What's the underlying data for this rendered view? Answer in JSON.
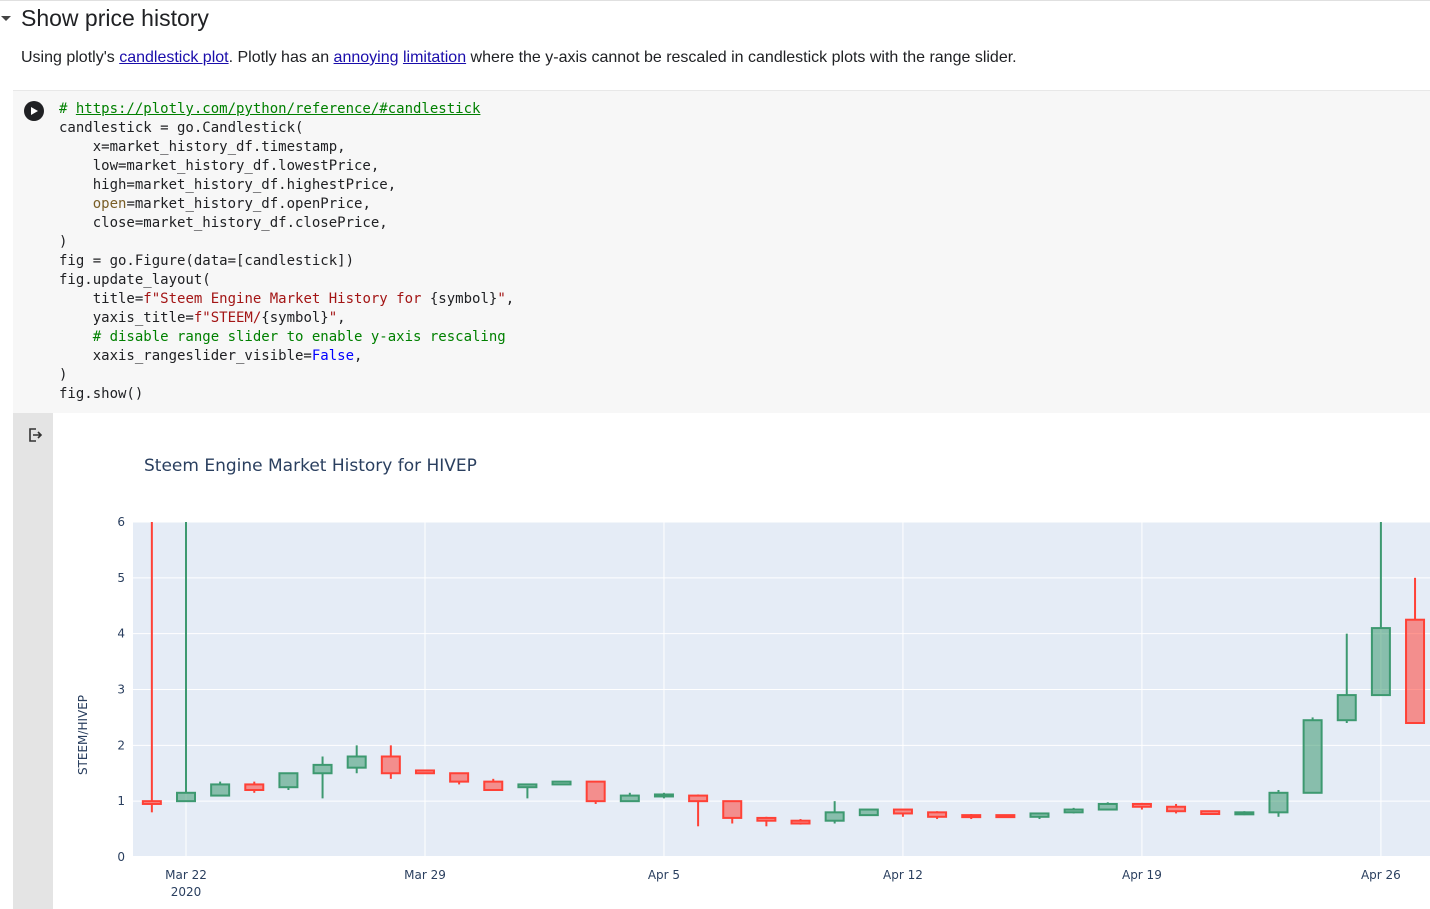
{
  "section": {
    "title": "Show price history",
    "caret_icon": "caret-down-icon"
  },
  "description": {
    "prefix": "Using plotly's ",
    "link1": "candlestick plot",
    "mid": ". Plotly has an ",
    "link2": "annoying",
    "space": " ",
    "link3": "limitation",
    "suffix": " where the y-axis cannot be rescaled in candlestick plots with the range slider."
  },
  "cell": {
    "run_icon": "play-icon",
    "output_icon": "output-redirect-icon",
    "code": {
      "l1_hash": "# ",
      "l1_url": "https://plotly.com/python/reference/#candlestick",
      "l2": "candlestick = go.Candlestick(",
      "l3": "    x=market_history_df.timestamp,",
      "l4": "    low=market_history_df.lowestPrice,",
      "l5": "    high=market_history_df.highestPrice,",
      "l6_indent": "    ",
      "l6_kw": "open",
      "l6_rest": "=market_history_df.openPrice,",
      "l7": "    close=market_history_df.closePrice,",
      "l8": ")",
      "l9": "fig = go.Figure(data=[candlestick])",
      "l10": "fig.update_layout(",
      "l11_a": "    title=",
      "l11_str1": "f\"Steem Engine Market History for ",
      "l11_var": "{symbol}",
      "l11_str2": "\"",
      "l11_end": ",",
      "l12_a": "    yaxis_title=",
      "l12_str1": "f\"STEEM/",
      "l12_var": "{symbol}",
      "l12_str2": "\"",
      "l12_end": ",",
      "l13": "    # disable range slider to enable y-axis rescaling",
      "l14_a": "    xaxis_rangeslider_visible=",
      "l14_kw": "False",
      "l14_end": ",",
      "l15": ")",
      "l16": "fig.show()"
    }
  },
  "chart_data": {
    "type": "candlestick",
    "title": "Steem Engine Market History for HIVEP",
    "ylabel": "STEEM/HIVEP",
    "xlabel": "",
    "ylim": [
      0,
      6
    ],
    "yticks": [
      0,
      1,
      2,
      3,
      4,
      5,
      6
    ],
    "xticks": [
      {
        "label": "Mar 22",
        "sub": "2020",
        "day": 0
      },
      {
        "label": "Mar 29",
        "sub": "",
        "day": 7
      },
      {
        "label": "Apr 5",
        "sub": "",
        "day": 14
      },
      {
        "label": "Apr 12",
        "sub": "",
        "day": 21
      },
      {
        "label": "Apr 19",
        "sub": "",
        "day": 28
      },
      {
        "label": "Apr 26",
        "sub": "",
        "day": 35
      }
    ],
    "grid": true,
    "legend": "none",
    "colors": {
      "increasing": "#3d9970",
      "decreasing": "#ff4136",
      "plot_bg": "#e5ecf6",
      "text": "#2a3f5f"
    },
    "candles": [
      {
        "day": -1,
        "open": 1.0,
        "high": 6.0,
        "low": 0.8,
        "close": 0.95
      },
      {
        "day": 0,
        "open": 1.0,
        "high": 6.0,
        "low": 1.0,
        "close": 1.15
      },
      {
        "day": 1,
        "open": 1.1,
        "high": 1.35,
        "low": 1.1,
        "close": 1.3
      },
      {
        "day": 2,
        "open": 1.3,
        "high": 1.35,
        "low": 1.15,
        "close": 1.2
      },
      {
        "day": 3,
        "open": 1.25,
        "high": 1.5,
        "low": 1.2,
        "close": 1.5
      },
      {
        "day": 4,
        "open": 1.5,
        "high": 1.8,
        "low": 1.05,
        "close": 1.65
      },
      {
        "day": 5,
        "open": 1.6,
        "high": 2.0,
        "low": 1.5,
        "close": 1.8
      },
      {
        "day": 6,
        "open": 1.8,
        "high": 2.0,
        "low": 1.4,
        "close": 1.5
      },
      {
        "day": 7,
        "open": 1.55,
        "high": 1.55,
        "low": 1.5,
        "close": 1.5
      },
      {
        "day": 8,
        "open": 1.5,
        "high": 1.5,
        "low": 1.3,
        "close": 1.35
      },
      {
        "day": 9,
        "open": 1.35,
        "high": 1.4,
        "low": 1.2,
        "close": 1.2
      },
      {
        "day": 10,
        "open": 1.25,
        "high": 1.3,
        "low": 1.05,
        "close": 1.3
      },
      {
        "day": 11,
        "open": 1.3,
        "high": 1.35,
        "low": 1.3,
        "close": 1.35
      },
      {
        "day": 12,
        "open": 1.35,
        "high": 1.35,
        "low": 0.95,
        "close": 1.0
      },
      {
        "day": 13,
        "open": 1.0,
        "high": 1.15,
        "low": 1.0,
        "close": 1.1
      },
      {
        "day": 14,
        "open": 1.1,
        "high": 1.15,
        "low": 1.05,
        "close": 1.12
      },
      {
        "day": 15,
        "open": 1.1,
        "high": 1.12,
        "low": 0.55,
        "close": 1.0
      },
      {
        "day": 16,
        "open": 1.0,
        "high": 1.0,
        "low": 0.6,
        "close": 0.7
      },
      {
        "day": 17,
        "open": 0.7,
        "high": 0.72,
        "low": 0.55,
        "close": 0.65
      },
      {
        "day": 18,
        "open": 0.65,
        "high": 0.68,
        "low": 0.58,
        "close": 0.6
      },
      {
        "day": 19,
        "open": 0.65,
        "high": 1.0,
        "low": 0.6,
        "close": 0.8
      },
      {
        "day": 20,
        "open": 0.75,
        "high": 0.85,
        "low": 0.75,
        "close": 0.85
      },
      {
        "day": 21,
        "open": 0.85,
        "high": 0.85,
        "low": 0.72,
        "close": 0.78
      },
      {
        "day": 22,
        "open": 0.8,
        "high": 0.82,
        "low": 0.68,
        "close": 0.72
      },
      {
        "day": 23,
        "open": 0.75,
        "high": 0.77,
        "low": 0.68,
        "close": 0.73
      },
      {
        "day": 24,
        "open": 0.75,
        "high": 0.76,
        "low": 0.7,
        "close": 0.72
      },
      {
        "day": 25,
        "open": 0.72,
        "high": 0.78,
        "low": 0.68,
        "close": 0.78
      },
      {
        "day": 26,
        "open": 0.8,
        "high": 0.88,
        "low": 0.78,
        "close": 0.85
      },
      {
        "day": 27,
        "open": 0.85,
        "high": 0.98,
        "low": 0.85,
        "close": 0.95
      },
      {
        "day": 28,
        "open": 0.95,
        "high": 0.97,
        "low": 0.85,
        "close": 0.9
      },
      {
        "day": 29,
        "open": 0.9,
        "high": 0.95,
        "low": 0.78,
        "close": 0.82
      },
      {
        "day": 30,
        "open": 0.82,
        "high": 0.83,
        "low": 0.76,
        "close": 0.77
      },
      {
        "day": 31,
        "open": 0.77,
        "high": 0.82,
        "low": 0.75,
        "close": 0.8
      },
      {
        "day": 32,
        "open": 0.8,
        "high": 1.2,
        "low": 0.72,
        "close": 1.15
      },
      {
        "day": 33,
        "open": 1.15,
        "high": 2.5,
        "low": 1.15,
        "close": 2.45
      },
      {
        "day": 34,
        "open": 2.45,
        "high": 4.0,
        "low": 2.4,
        "close": 2.9
      },
      {
        "day": 35,
        "open": 2.9,
        "high": 6.0,
        "low": 2.9,
        "close": 4.1
      },
      {
        "day": 36,
        "open": 4.25,
        "high": 5.0,
        "low": 2.4,
        "close": 2.4
      }
    ]
  }
}
